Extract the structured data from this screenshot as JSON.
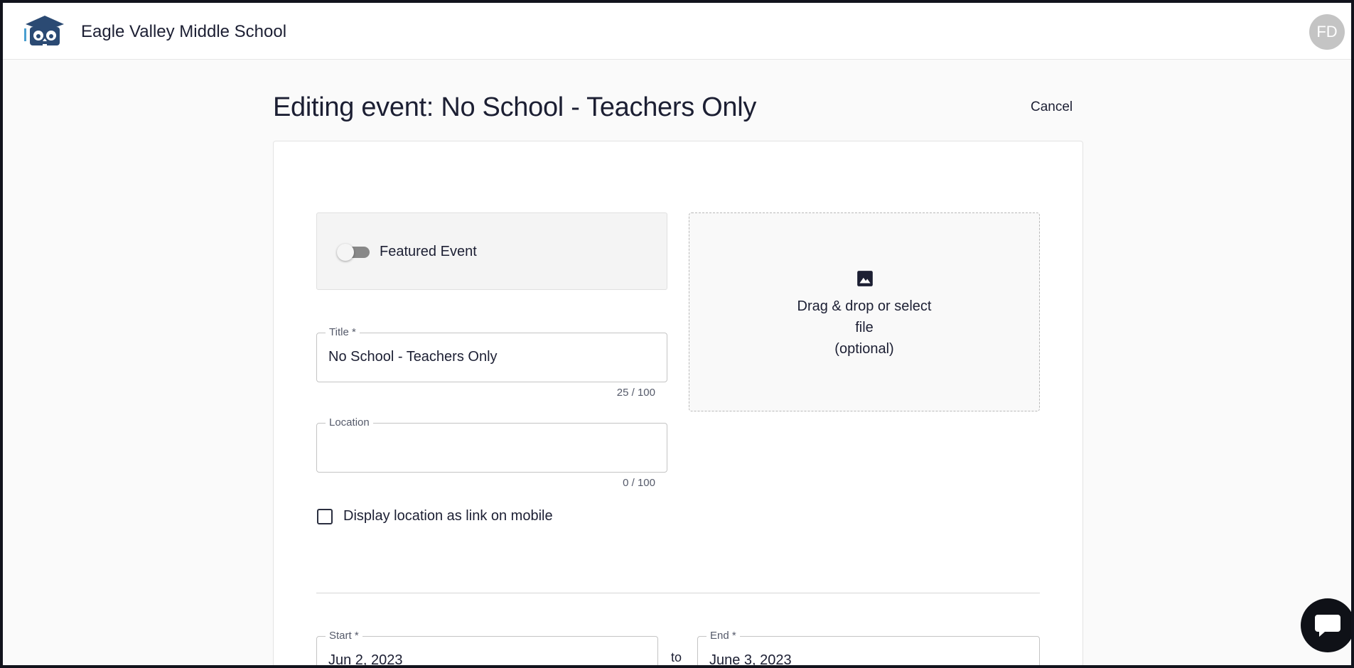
{
  "header": {
    "school_name": "Eagle Valley Middle School",
    "avatar_initials": "FD"
  },
  "page": {
    "title": "Editing event: No School - Teachers Only",
    "cancel_label": "Cancel"
  },
  "form": {
    "featured": {
      "label": "Featured Event",
      "enabled": false
    },
    "upload": {
      "line1": "Drag & drop or select",
      "line2": "file",
      "line3": "(optional)"
    },
    "title_field": {
      "label": "Title *",
      "value": "No School - Teachers Only",
      "counter": "25 / 100"
    },
    "location_field": {
      "label": "Location",
      "value": "",
      "counter": "0 / 100"
    },
    "location_link": {
      "label": "Display location as link on mobile",
      "checked": false
    },
    "start_field": {
      "label": "Start *",
      "value": "Jun 2, 2023"
    },
    "range_separator": "to",
    "end_field": {
      "label": "End *",
      "value": "June 3, 2023"
    }
  },
  "colors": {
    "text": "#1c1f33",
    "logo": "#2b4a73",
    "chat": "#0f1117"
  },
  "icons": {
    "logo": "owl-graduation-cap-icon",
    "upload": "image-icon",
    "chat": "chat-bubble-icon"
  }
}
